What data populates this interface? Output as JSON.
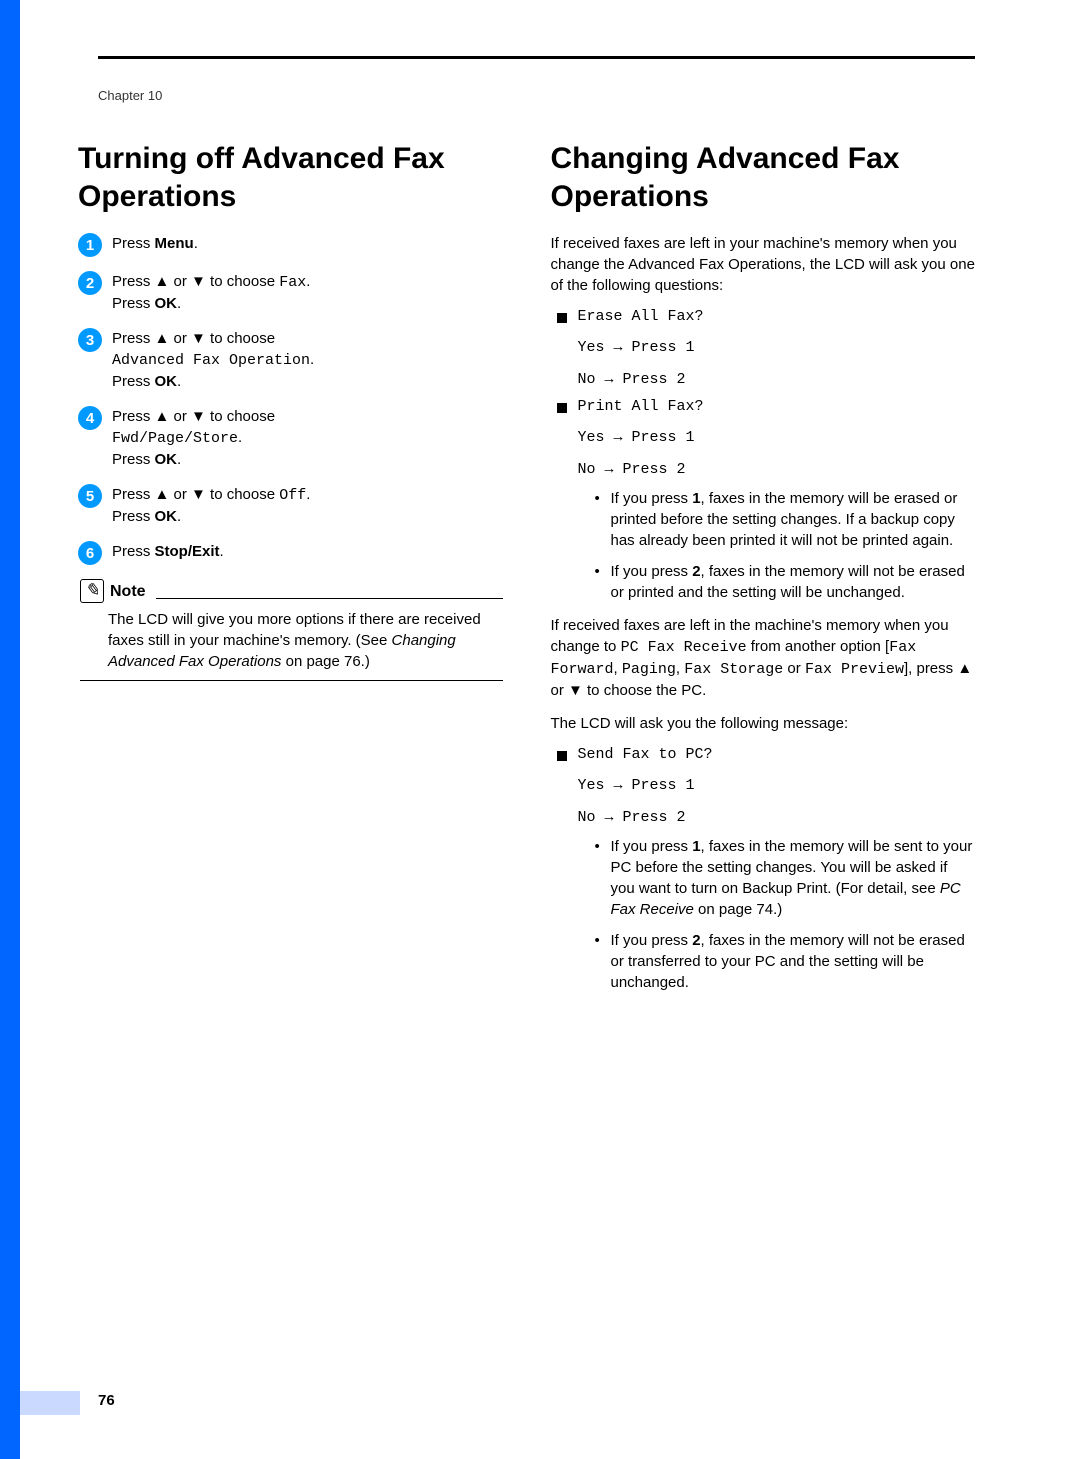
{
  "chapter": "Chapter 10",
  "page_number": "76",
  "left": {
    "heading": "Turning off Advanced Fax Operations",
    "steps": [
      {
        "n": "1",
        "pre": "Press ",
        "bold": "Menu",
        "post": "."
      },
      {
        "n": "2",
        "pre": "Press ▲ or ▼ to choose ",
        "mono": "Fax",
        "post1": ".",
        "line2_pre": "Press ",
        "line2_bold": "OK",
        "line2_post": "."
      },
      {
        "n": "3",
        "pre": "Press ▲ or ▼ to choose",
        "mono_line": "Advanced Fax Operation",
        "post1": ".",
        "line2_pre": "Press ",
        "line2_bold": "OK",
        "line2_post": "."
      },
      {
        "n": "4",
        "pre": "Press ▲ or ▼ to choose",
        "mono_line": "Fwd/Page/Store",
        "post1": ".",
        "line2_pre": "Press ",
        "line2_bold": "OK",
        "line2_post": "."
      },
      {
        "n": "5",
        "pre": "Press ▲ or ▼ to choose ",
        "mono": "Off",
        "post1": ".",
        "line2_pre": "Press ",
        "line2_bold": "OK",
        "line2_post": "."
      },
      {
        "n": "6",
        "pre": "Press ",
        "bold": "Stop/Exit",
        "post": "."
      }
    ],
    "note_title": "Note",
    "note_text_1": "The LCD will give you more options if there are received faxes still in your machine's memory. (See ",
    "note_em": "Changing Advanced Fax Operations",
    "note_text_2": " on page 76.)"
  },
  "right": {
    "heading": "Changing Advanced Fax Operations",
    "intro": "If received faxes are left in your machine's memory when you change the Advanced Fax Operations, the LCD will ask you one of the following questions:",
    "prompt1": {
      "q": "Erase All Fax?",
      "yes": "Yes  → Press 1",
      "no": "No   → Press 2"
    },
    "prompt2": {
      "q": "Print All Fax?",
      "yes": "Yes  → Press 1",
      "no": "No   → Press 2"
    },
    "sub1_pre": "If you press ",
    "sub1_bold": "1",
    "sub1_post": ", faxes in the memory will be erased or printed before the setting changes. If a backup copy has already been printed it will not be printed again.",
    "sub2_pre": "If you press ",
    "sub2_bold": "2",
    "sub2_post": ", faxes in the memory will not be erased or printed and the setting will be unchanged.",
    "mid_1": "If received faxes are left in the machine's memory when you change to ",
    "mid_m1": "PC Fax Receive",
    "mid_2": " from another option [",
    "mid_m2": "Fax Forward",
    "mid_c1": ", ",
    "mid_m3": "Paging",
    "mid_c2": ", ",
    "mid_m4": "Fax Storage",
    "mid_3": " or ",
    "mid_m5": "Fax Preview",
    "mid_4": "], press ▲ or ▼ to choose the PC.",
    "mid_outro": "The LCD will ask you the following message:",
    "prompt3": {
      "q": "Send Fax to PC?",
      "yes": "Yes  → Press 1",
      "no": "No   → Press 2"
    },
    "sub3_pre": "If you press ",
    "sub3_bold": "1",
    "sub3_post_a": ", faxes in the memory will be sent to your PC before the setting changes. You will be asked if you want to turn on Backup Print. (For detail, see ",
    "sub3_em": "PC Fax Receive",
    "sub3_post_b": " on page 74.)",
    "sub4_pre": "If you press ",
    "sub4_bold": "2",
    "sub4_post": ", faxes in the memory will not be erased or transferred to your PC and the setting will be unchanged."
  }
}
